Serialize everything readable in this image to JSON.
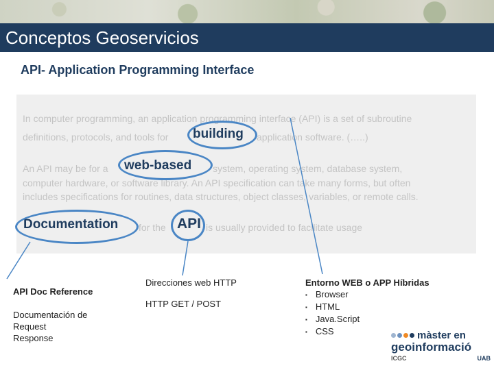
{
  "header": {
    "title": "Conceptos Geoservicios"
  },
  "subtitle": "API- Application Programming Interface",
  "quote": {
    "line1": "In computer programming, an application programming interface (API) is a set of subroutine",
    "line2a": "definitions, protocols, and tools for",
    "line2b": "building",
    "line2c": "application software.  (…..)",
    "line3a": "An API may be for a",
    "line3b": "web-based",
    "line3c": "system, operating system, database system,",
    "line4": "computer hardware, or software library. An API specification can take many forms, but often",
    "line5": "includes specifications for routines, data structures, object classes, variables, or remote calls.",
    "line6a": "Documentation",
    "line6b": "for the",
    "line6c": "API",
    "line6d": "is usually provided to facilitate usage"
  },
  "left_column": {
    "heading": "API Doc Reference",
    "lines": [
      "Documentación de",
      "Request",
      "Response"
    ]
  },
  "middle_column": {
    "heading": "Direcciones web HTTP",
    "line": "HTTP GET / POST"
  },
  "right_column": {
    "heading": "Entorno WEB o APP Híbridas",
    "items": [
      "Browser",
      "HTML",
      "Java.Script",
      "CSS"
    ]
  },
  "logo": {
    "line1": "màster en",
    "line2": "geoinformació",
    "badge_left": "ICGC",
    "badge_right": "UAB"
  },
  "colors": {
    "title_bar": "#1f3c5e",
    "ellipse": "#4a86c5",
    "quote_bg": "#efefef"
  }
}
